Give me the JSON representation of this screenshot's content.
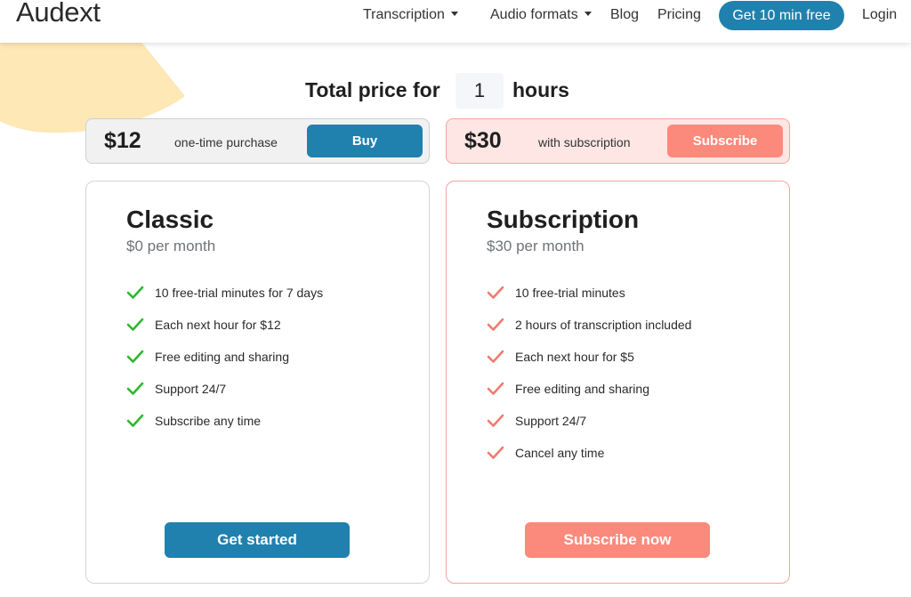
{
  "colors": {
    "brand_blue": "#2181ae",
    "coral": "#fb8a7c",
    "coral_light_bg": "#fde6e3",
    "check_green": "#2db82d",
    "check_coral": "#f27a6e",
    "deco_yellow": "#fde8b6"
  },
  "nav": {
    "logo": "Audext",
    "items": [
      {
        "label": "Transcription",
        "icon": "chevron-down-icon"
      },
      {
        "label": "Audio formats",
        "icon": "chevron-down-icon"
      },
      {
        "label": "Blog"
      },
      {
        "label": "Pricing"
      }
    ],
    "cta": "Get 10 min free",
    "login": "Login"
  },
  "total": {
    "prefix": "Total price for",
    "hours_value": "1",
    "suffix": "hours"
  },
  "price_bars": {
    "classic": {
      "amount": "$12",
      "note": "one-time purchase",
      "button": "Buy"
    },
    "subscription": {
      "amount": "$30",
      "note": "with subscription",
      "button": "Subscribe"
    }
  },
  "plans": {
    "classic": {
      "title": "Classic",
      "price": "$0 per month",
      "features": [
        "10 free-trial minutes for 7 days",
        "Each next hour for $12",
        "Free editing and sharing",
        "Support 24/7",
        "Subscribe any time"
      ],
      "button": "Get started",
      "check_icon": "check-icon"
    },
    "subscription": {
      "title": "Subscription",
      "price": "$30 per month",
      "features": [
        "10 free-trial minutes",
        "2 hours of transcription included",
        "Each next hour for $5",
        "Free editing and sharing",
        "Support 24/7",
        "Cancel any time"
      ],
      "button": "Subscribe now",
      "check_icon": "check-icon"
    }
  }
}
